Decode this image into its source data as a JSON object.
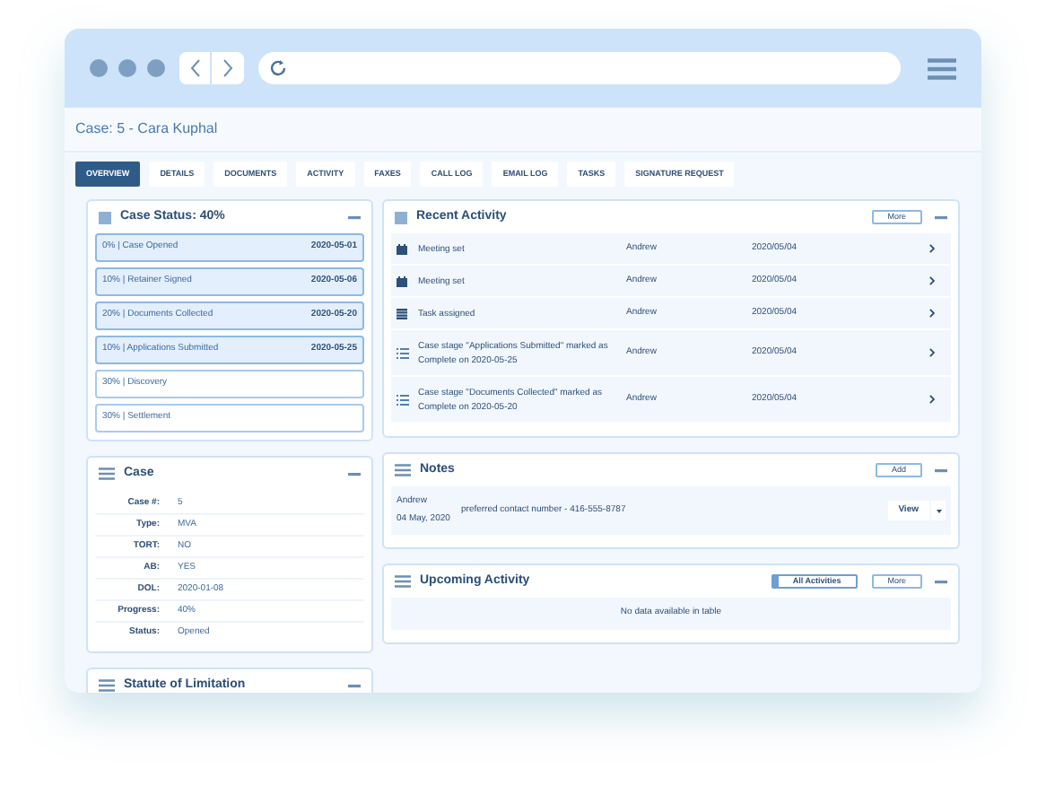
{
  "page": {
    "title": "Case: 5 - Cara Kuphal"
  },
  "tabs": [
    {
      "label": "OVERVIEW",
      "selected": true
    },
    {
      "label": "DETAILS",
      "selected": false
    },
    {
      "label": "DOCUMENTS",
      "selected": false
    },
    {
      "label": "ACTIVITY",
      "selected": false
    },
    {
      "label": "FAXES",
      "selected": false
    },
    {
      "label": "CALL LOG",
      "selected": false
    },
    {
      "label": "EMAIL LOG",
      "selected": false
    },
    {
      "label": "TASKS",
      "selected": false
    },
    {
      "label": "SIGNATURE REQUEST",
      "selected": false
    }
  ],
  "case_status": {
    "title": "Case Status: 40%",
    "stages": [
      {
        "label": "0% | Case Opened",
        "date": "2020-05-01",
        "completed": true
      },
      {
        "label": "10% | Retainer Signed",
        "date": "2020-05-06",
        "completed": true
      },
      {
        "label": "20% | Documents Collected",
        "date": "2020-05-20",
        "completed": true
      },
      {
        "label": "10% | Applications Submitted",
        "date": "2020-05-25",
        "completed": true
      },
      {
        "label": "30% | Discovery",
        "completed": false
      },
      {
        "label": "30% | Settlement",
        "completed": false
      }
    ]
  },
  "case": {
    "title": "Case",
    "fields": [
      {
        "label": "Case #:",
        "value": "5"
      },
      {
        "label": "Type:",
        "value": "MVA"
      },
      {
        "label": "TORT:",
        "value": "NO"
      },
      {
        "label": "AB:",
        "value": "YES"
      },
      {
        "label": "DOL:",
        "value": "2020-01-08"
      },
      {
        "label": "Progress:",
        "value": "40%"
      },
      {
        "label": "Status:",
        "value": "Opened"
      }
    ]
  },
  "statute": {
    "title": "Statute of Limitation"
  },
  "recent_activity": {
    "title": "Recent Activity",
    "more_button": "More",
    "rows": [
      {
        "kind": "meeting",
        "text": "Meeting set",
        "user": "Andrew",
        "date": "2020/05/04"
      },
      {
        "kind": "meeting",
        "text": "Meeting set",
        "user": "Andrew",
        "date": "2020/05/04"
      },
      {
        "kind": "task",
        "text": "Task assigned",
        "user": "Andrew",
        "date": "2020/05/04"
      },
      {
        "kind": "stage",
        "text": "Case stage \"Applications Submitted\" marked as Complete on 2020-05-25",
        "user": "Andrew",
        "date": "2020/05/04"
      },
      {
        "kind": "stage",
        "text": "Case stage \"Documents Collected\" marked as Complete on 2020-05-20",
        "user": "Andrew",
        "date": "2020/05/04"
      }
    ]
  },
  "notes": {
    "title": "Notes",
    "add_button": "Add",
    "items": [
      {
        "author": "Andrew",
        "date": "04 May, 2020",
        "text": "preferred contact number - 416-555-8787",
        "view_button": "View"
      }
    ]
  },
  "upcoming_activity": {
    "title": "Upcoming Activity",
    "filter_button": "All Activities",
    "more_button": "More",
    "empty_message": "No data available in table"
  }
}
